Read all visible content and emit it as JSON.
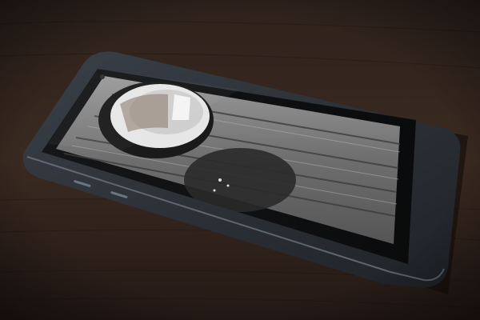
{
  "colors": {
    "table_wood_dark": "#1c1410",
    "table_wood_mid": "#3a2a21",
    "table_wood_light": "#4a372c",
    "phone_frame": "#2d3239",
    "phone_edge_highlight": "#6b7480",
    "screen_black": "#0d0e10",
    "photo_wood_light": "#8e8e8e",
    "photo_wood_dark": "#3c3c3c",
    "cup_white": "#e6e6e6",
    "cup_shadow": "#1a1a1a"
  },
  "icons": {
    "phone": "smartphone-icon",
    "camera": "front-camera-icon"
  }
}
